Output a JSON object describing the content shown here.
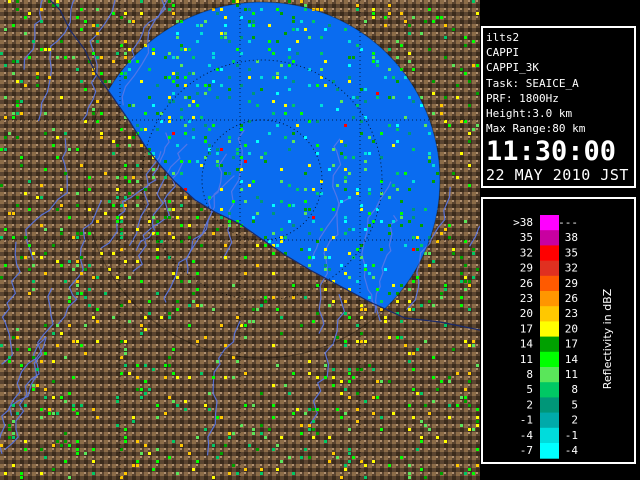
{
  "info": {
    "site": "ilts2",
    "product": "CAPPI",
    "product_name": "CAPPI_3K",
    "task": "Task: SEAICE_A",
    "prf": "PRF: 1800Hz",
    "height": "Height:3.0 km",
    "max_range": "Max Range:80 km",
    "time": "11:30:00",
    "date": "22 MAY 2010 JST"
  },
  "legend": {
    "axis_label": "Reflectivity in dBZ",
    "bins": [
      {
        "low": ">38",
        "high": "---",
        "color": "#ff00ff"
      },
      {
        "low": "35",
        "high": "38",
        "color": "#c800a0"
      },
      {
        "low": "32",
        "high": "35",
        "color": "#ff0000"
      },
      {
        "low": "29",
        "high": "32",
        "color": "#e03020"
      },
      {
        "low": "26",
        "high": "29",
        "color": "#ff5a00"
      },
      {
        "low": "23",
        "high": "26",
        "color": "#ff9600"
      },
      {
        "low": "20",
        "high": "23",
        "color": "#ffc800"
      },
      {
        "low": "17",
        "high": "20",
        "color": "#ffff00"
      },
      {
        "low": "14",
        "high": "17",
        "color": "#00a000"
      },
      {
        "low": "11",
        "high": "14",
        "color": "#00ff00"
      },
      {
        "low": "8",
        "high": "11",
        "color": "#5ae65a"
      },
      {
        "low": "5",
        "high": "8",
        "color": "#00c864"
      },
      {
        "low": "2",
        "high": "5",
        "color": "#009678"
      },
      {
        "low": "-1",
        "high": "2",
        "color": "#00aaaa"
      },
      {
        "low": "-4",
        "high": "-1",
        "color": "#00dcdc"
      },
      {
        "low": "-7",
        "high": "-4",
        "color": "#00ffff"
      }
    ]
  },
  "colors": {
    "sea": "#0a6cf0",
    "terrain_dark": "#4a3724",
    "terrain_light": "#a88660",
    "rivers": "#5a78e8",
    "range_rings": "#000000"
  }
}
